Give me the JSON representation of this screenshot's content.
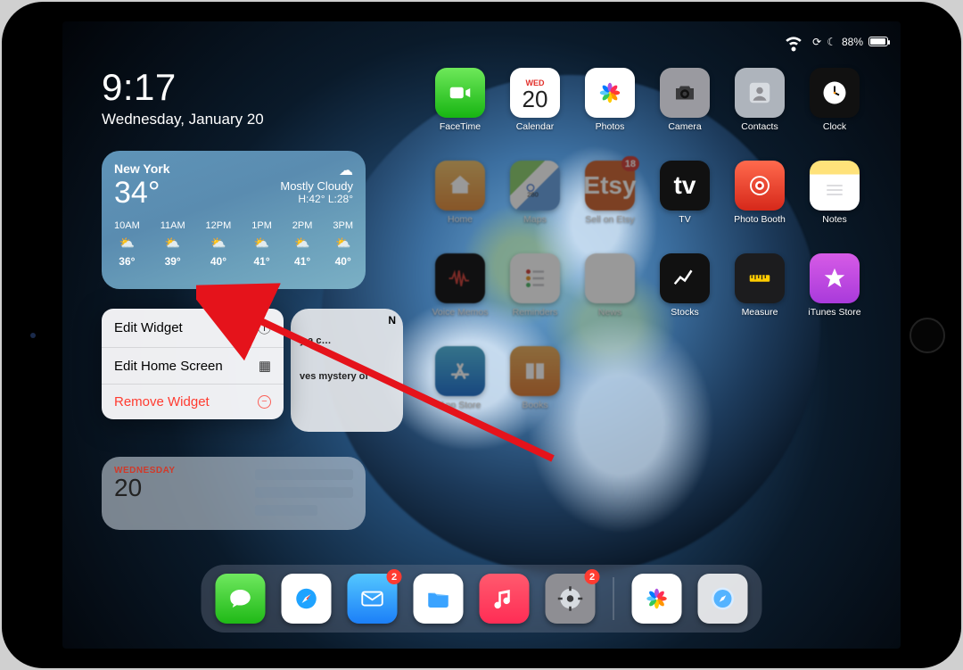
{
  "status": {
    "battery_pct": "88%"
  },
  "clock": {
    "time": "9:17",
    "date": "Wednesday, January 20"
  },
  "weather": {
    "location": "New York",
    "temp": "34°",
    "condition": "Mostly Cloudy",
    "hilo": "H:42° L:28°",
    "hours": [
      {
        "h": "10AM",
        "t": "36°"
      },
      {
        "h": "11AM",
        "t": "39°"
      },
      {
        "h": "12PM",
        "t": "40°"
      },
      {
        "h": "1PM",
        "t": "41°"
      },
      {
        "h": "2PM",
        "t": "41°"
      },
      {
        "h": "3PM",
        "t": "40°"
      }
    ]
  },
  "context_menu": {
    "edit_widget": "Edit Widget",
    "edit_home": "Edit Home Screen",
    "remove": "Remove Widget"
  },
  "news": {
    "headline1": "y a c…",
    "headline2": "ves mystery of"
  },
  "calendar_widget": {
    "dow": "WEDNESDAY",
    "day": "20"
  },
  "apps": {
    "facetime": "FaceTime",
    "calendar": "Calendar",
    "photos": "Photos",
    "camera": "Camera",
    "contacts": "Contacts",
    "clock": "Clock",
    "home": "Home",
    "maps": "Maps",
    "etsy": "Sell on Etsy",
    "tv": "TV",
    "booth": "Photo Booth",
    "notes": "Notes",
    "voice": "Voice Memos",
    "reminders": "Reminders",
    "news": "News",
    "stocks": "Stocks",
    "measure": "Measure",
    "itunes": "iTunes Store",
    "appstore": "App Store",
    "books": "Books",
    "cal_wk": "WED",
    "cal_day": "20",
    "etsy_badge": "18",
    "etsy_text": "Etsy",
    "tv_text": "tv",
    "news_glyph": "N"
  },
  "dock": {
    "mail_badge": "2",
    "settings_badge": "2"
  }
}
